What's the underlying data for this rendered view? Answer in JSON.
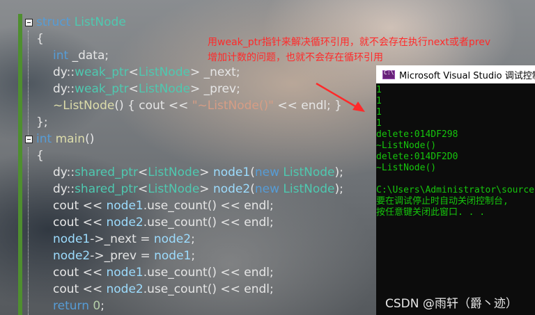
{
  "annotation": {
    "line1": "用weak_ptr指针来解决循环引用，就不会存在执行next或者prev",
    "line2": "增加计数的问题，也就不会存在循环引用"
  },
  "console": {
    "title": "Microsoft Visual Studio 调试控制台",
    "lines": [
      "1",
      "1",
      "1",
      "1",
      "delete:014DF298",
      "~ListNode()",
      "delete:014DF2D0",
      "~ListNode()",
      "",
      "C:\\Users\\Administrator\\source",
      "要在调试停止时自动关闭控制台,",
      "按任意键关闭此窗口. . ."
    ]
  },
  "watermark": "CSDN @雨轩（爵丶迹）",
  "code_colors": {
    "keyword": "#569cd6",
    "type": "#4ec9b0",
    "identifier": "#9cdcfe",
    "text": "#e6e6e6",
    "string": "#d69d85",
    "annotation": "#ff2a2a",
    "console_text": "#16c60c"
  },
  "code": {
    "struct_kw": "struct",
    "struct_name": "ListNode",
    "brace_open": "{",
    "brace_close_semi": "};",
    "int_kw": "int",
    "data_member": " _data;",
    "ns": "dy::",
    "weak_ptr": "weak_ptr",
    "shared_ptr": "shared_ptr",
    "lt": "<",
    "gt": ">",
    "listnode": "ListNode",
    "next_member": " _next;",
    "prev_member": " _prev;",
    "dtor_name": "~ListNode",
    "dtor_rest_a": "() { cout << ",
    "dtor_string": "\"~ListNode()\"",
    "dtor_rest_b": " << endl; }",
    "main_name": "main",
    "main_parens": "()",
    "node1_decl": " node1",
    "node2_decl": " node2",
    "paren_open": "(",
    "new_kw": "new",
    "paren_close_semi": ");",
    "cout": "cout << ",
    "node1": "node1",
    "node2": "node2",
    "use_count": ".use_count() << endl;",
    "arrow_next": "->_next = ",
    "arrow_prev": "->_prev = ",
    "semi": ";",
    "return_kw": "return",
    "return_val": "0",
    "space": " "
  }
}
